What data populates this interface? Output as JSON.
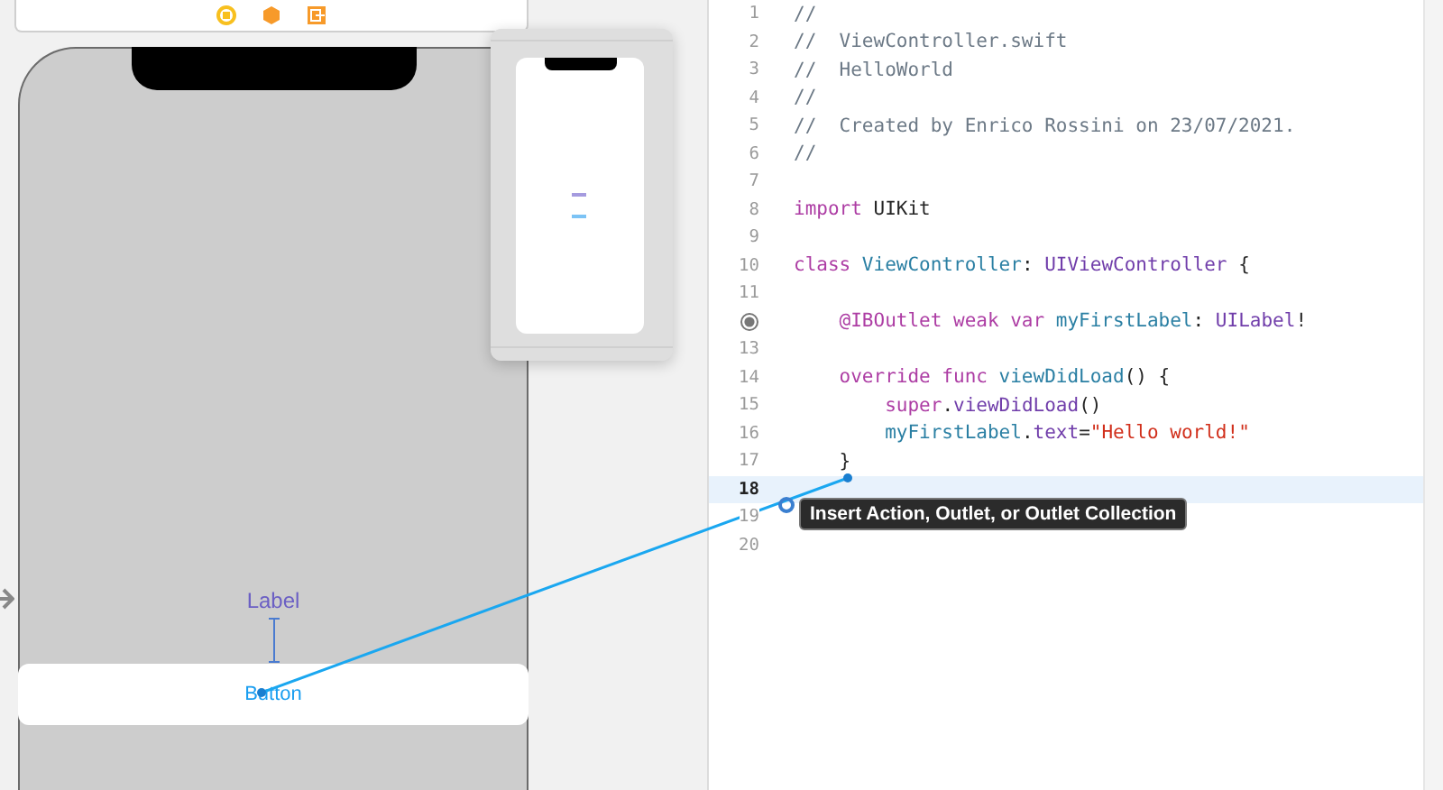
{
  "canvas": {
    "scene_label": "Label",
    "scene_button": "Button"
  },
  "editor": {
    "lines": [
      {
        "number": "1",
        "current": false,
        "kind": "text",
        "tokens": [
          {
            "kind": "comment",
            "text": "//"
          }
        ]
      },
      {
        "number": "2",
        "current": false,
        "kind": "text",
        "tokens": [
          {
            "kind": "comment",
            "text": "//  ViewController.swift"
          }
        ]
      },
      {
        "number": "3",
        "current": false,
        "kind": "text",
        "tokens": [
          {
            "kind": "comment",
            "text": "//  HelloWorld"
          }
        ]
      },
      {
        "number": "4",
        "current": false,
        "kind": "text",
        "tokens": [
          {
            "kind": "comment",
            "text": "//"
          }
        ]
      },
      {
        "number": "5",
        "current": false,
        "kind": "text",
        "tokens": [
          {
            "kind": "comment",
            "text": "//  Created by Enrico Rossini on 23/07/2021."
          }
        ]
      },
      {
        "number": "6",
        "current": false,
        "kind": "text",
        "tokens": [
          {
            "kind": "comment",
            "text": "//"
          }
        ]
      },
      {
        "number": "7",
        "current": false,
        "kind": "text"
      },
      {
        "number": "8",
        "current": false,
        "kind": "text",
        "tokens": [
          {
            "kind": "keyword",
            "text": "import"
          },
          {
            "kind": "plain",
            "text": " UIKit"
          }
        ]
      },
      {
        "number": "9",
        "current": false,
        "kind": "text"
      },
      {
        "number": "10",
        "current": false,
        "kind": "text",
        "tokens": [
          {
            "kind": "keyword",
            "text": "class"
          },
          {
            "kind": "decl",
            "text": " ViewController"
          },
          {
            "kind": "plain",
            "text": ": "
          },
          {
            "kind": "type",
            "text": "UIViewController"
          },
          {
            "kind": "plain",
            "text": " {"
          }
        ]
      },
      {
        "number": "11",
        "current": false,
        "kind": "text"
      },
      {
        "current": false,
        "kind": "outlet",
        "tokens": [
          {
            "kind": "keyword",
            "text": "    @IBOutlet weak var"
          },
          {
            "kind": "decl",
            "text": " myFirstLabel"
          },
          {
            "kind": "plain",
            "text": ": "
          },
          {
            "kind": "type",
            "text": "UILabel"
          },
          {
            "kind": "plain",
            "text": "!"
          }
        ]
      },
      {
        "number": "13",
        "current": false,
        "kind": "text"
      },
      {
        "number": "14",
        "current": false,
        "kind": "text",
        "tokens": [
          {
            "kind": "keyword",
            "text": "    override func"
          },
          {
            "kind": "decl",
            "text": " viewDidLoad"
          },
          {
            "kind": "plain",
            "text": "() {"
          }
        ]
      },
      {
        "number": "15",
        "current": false,
        "kind": "text",
        "tokens": [
          {
            "kind": "keyword",
            "text": "        super"
          },
          {
            "kind": "plain",
            "text": "."
          },
          {
            "kind": "type",
            "text": "viewDidLoad"
          },
          {
            "kind": "plain",
            "text": "()"
          }
        ]
      },
      {
        "number": "16",
        "current": false,
        "kind": "text",
        "tokens": [
          {
            "kind": "decl",
            "text": "        myFirstLabel"
          },
          {
            "kind": "plain",
            "text": "."
          },
          {
            "kind": "type",
            "text": "text"
          },
          {
            "kind": "plain",
            "text": "="
          },
          {
            "kind": "string",
            "text": "\"Hello world!\""
          }
        ]
      },
      {
        "number": "17",
        "current": false,
        "kind": "text",
        "tokens": [
          {
            "kind": "plain",
            "text": "    }"
          }
        ]
      },
      {
        "number": "18",
        "current": true,
        "kind": "text"
      },
      {
        "number": "19",
        "current": false,
        "kind": "text"
      },
      {
        "number": "20",
        "current": false,
        "kind": "text"
      }
    ]
  },
  "tooltip": {
    "text": "Insert Action, Outlet, or Outlet Collection"
  }
}
